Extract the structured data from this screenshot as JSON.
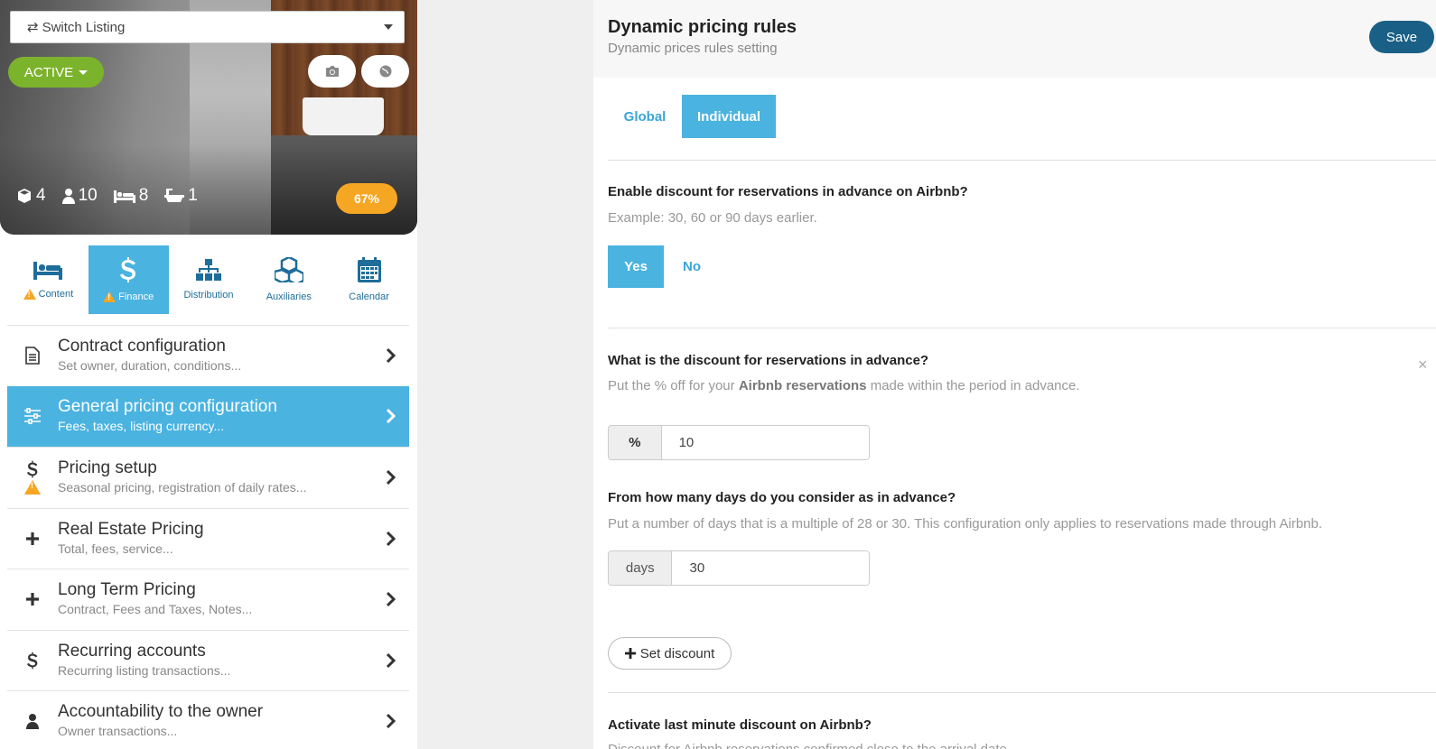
{
  "switch_listing": {
    "label": "Switch Listing"
  },
  "listing": {
    "status": "ACTIVE",
    "stats": {
      "units": "4",
      "guests": "10",
      "beds": "8",
      "bathrooms": "1"
    },
    "completion": "67%"
  },
  "modules": [
    {
      "label": "Content",
      "icon": "bed-icon",
      "warning": true
    },
    {
      "label": "Finance",
      "icon": "dollar-icon",
      "warning": true,
      "active": true
    },
    {
      "label": "Distribution",
      "icon": "sitemap-icon",
      "warning": false
    },
    {
      "label": "Auxiliaries",
      "icon": "cubes-icon",
      "warning": false
    },
    {
      "label": "Calendar",
      "icon": "calendar-icon",
      "warning": false
    }
  ],
  "menu": [
    {
      "title": "Contract configuration",
      "sub": "Set owner, duration, conditions...",
      "icon": "document-icon"
    },
    {
      "title": "General pricing configuration",
      "sub": "Fees, taxes, listing currency...",
      "icon": "sliders-icon",
      "active": true
    },
    {
      "title": "Pricing setup",
      "sub": "Seasonal pricing, registration of daily rates...",
      "icon": "dollar-icon"
    },
    {
      "title": "Real Estate Pricing",
      "sub": "Total, fees, service...",
      "icon": "plus-icon"
    },
    {
      "title": "Long Term Pricing",
      "sub": "Contract, Fees and Taxes, Notes...",
      "icon": "plus-icon"
    },
    {
      "title": "Recurring accounts",
      "sub": "Recurring listing transactions...",
      "icon": "dollar-icon"
    },
    {
      "title": "Accountability to the owner",
      "sub": "Owner transactions...",
      "icon": "user-icon"
    }
  ],
  "header": {
    "title": "Dynamic pricing rules",
    "subtitle": "Dynamic prices rules setting",
    "save_label": "Save"
  },
  "tabs": {
    "global": "Global",
    "individual": "Individual"
  },
  "advance_discount": {
    "question": "Enable discount for reservations in advance on Airbnb?",
    "example": "Example: 30, 60 or 90 days earlier.",
    "yes": "Yes",
    "no": "No"
  },
  "discount_rule": {
    "question": "What is the discount for reservations in advance?",
    "desc_prefix": "Put the % off for your ",
    "desc_bold": "Airbnb reservations",
    "desc_suffix": " made within the period in advance.",
    "percent_addon": "%",
    "percent_value": "10",
    "days_question": "From how many days do you consider as in advance?",
    "days_desc": "Put a number of days that is a multiple of 28 or 30. This configuration only applies to reservations made through Airbnb.",
    "days_addon": "days",
    "days_value": "30",
    "close": "×"
  },
  "set_discount_label": "Set discount",
  "last_minute": {
    "question": "Activate last minute discount on Airbnb?",
    "desc": "Discount for Airbnb reservations confirmed close to the arrival date."
  }
}
